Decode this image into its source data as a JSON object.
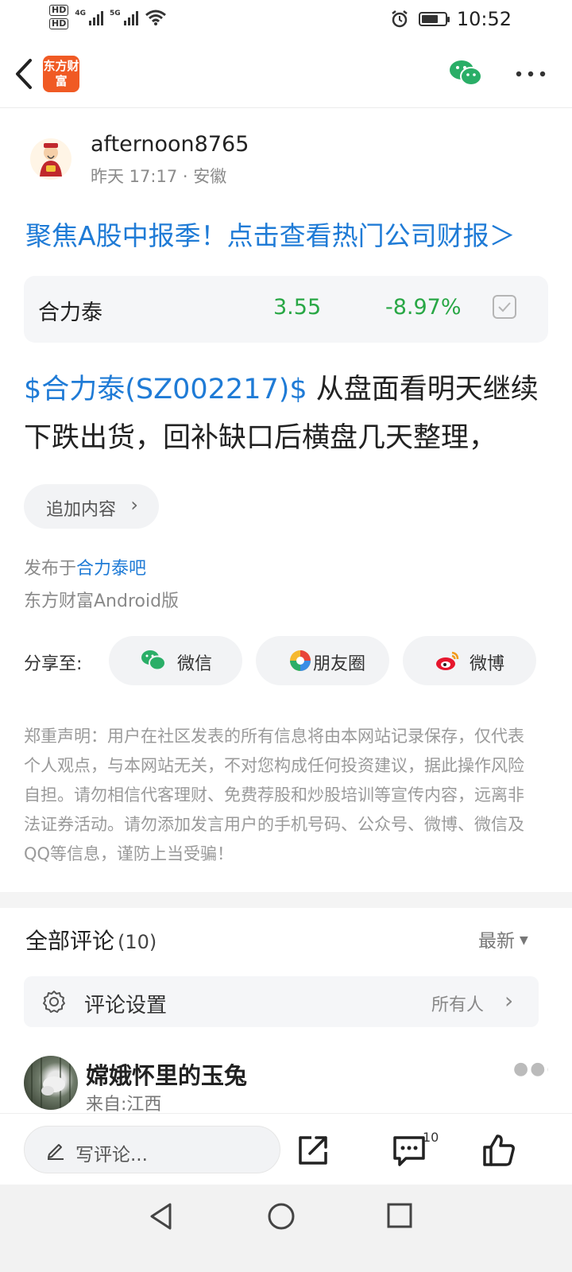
{
  "status_bar": {
    "hd1": "HD",
    "hd2": "HD",
    "net1": "4G",
    "net2": "5G",
    "time": "10:52",
    "battery_level": 0.7
  },
  "header": {
    "logo_text": "东方财富"
  },
  "author": {
    "name": "afternoon8765",
    "meta": "昨天 17:17 · 安徽"
  },
  "promo_banner": "聚焦A股中报季！点击查看热门公司财报＞",
  "stock_card": {
    "name": "合力泰",
    "price": "3.55",
    "change": "-8.97%"
  },
  "post": {
    "stock_link": "$合力泰(SZ002217)$",
    "text": " 从盘面看明天继续下跌出货，回补缺口后横盘几天整理，"
  },
  "append_button": "追加内容",
  "published": {
    "prefix": "发布于",
    "bar": "合力泰吧"
  },
  "platform": "东方财富Android版",
  "share": {
    "label": "分享至:",
    "wechat": "微信",
    "moments": "朋友圈",
    "weibo": "微博"
  },
  "disclaimer": "郑重声明：用户在社区发表的所有信息将由本网站记录保存，仅代表个人观点，与本网站无关，不对您构成任何投资建议，据此操作风险自担。请勿相信代客理财、免费荐股和炒股培训等宣传内容，远离非法证券活动。请勿添加发言用户的手机号码、公众号、微博、微信及QQ等信息，谨防上当受骗！",
  "comments": {
    "title": "全部评论",
    "count": "(10)",
    "sort": "最新",
    "settings_label": "评论设置",
    "settings_value": "所有人",
    "items": [
      {
        "name": "嫦娥怀里的玉兔",
        "location": "来自:江西"
      }
    ]
  },
  "action_bar": {
    "placeholder": "写评论...",
    "comment_count": "10"
  },
  "colors": {
    "link_blue": "#1f7bd6",
    "down_green": "#28a745",
    "brand_orange": "#f05a24",
    "wechat_green": "#2aae67"
  },
  "icons": [
    "back-icon",
    "wechat-icon",
    "more-icon",
    "checkbox-icon",
    "chevron-right-icon",
    "moments-icon",
    "weibo-icon",
    "gear-icon",
    "pen-icon",
    "share-out-icon",
    "comment-icon",
    "like-icon"
  ]
}
